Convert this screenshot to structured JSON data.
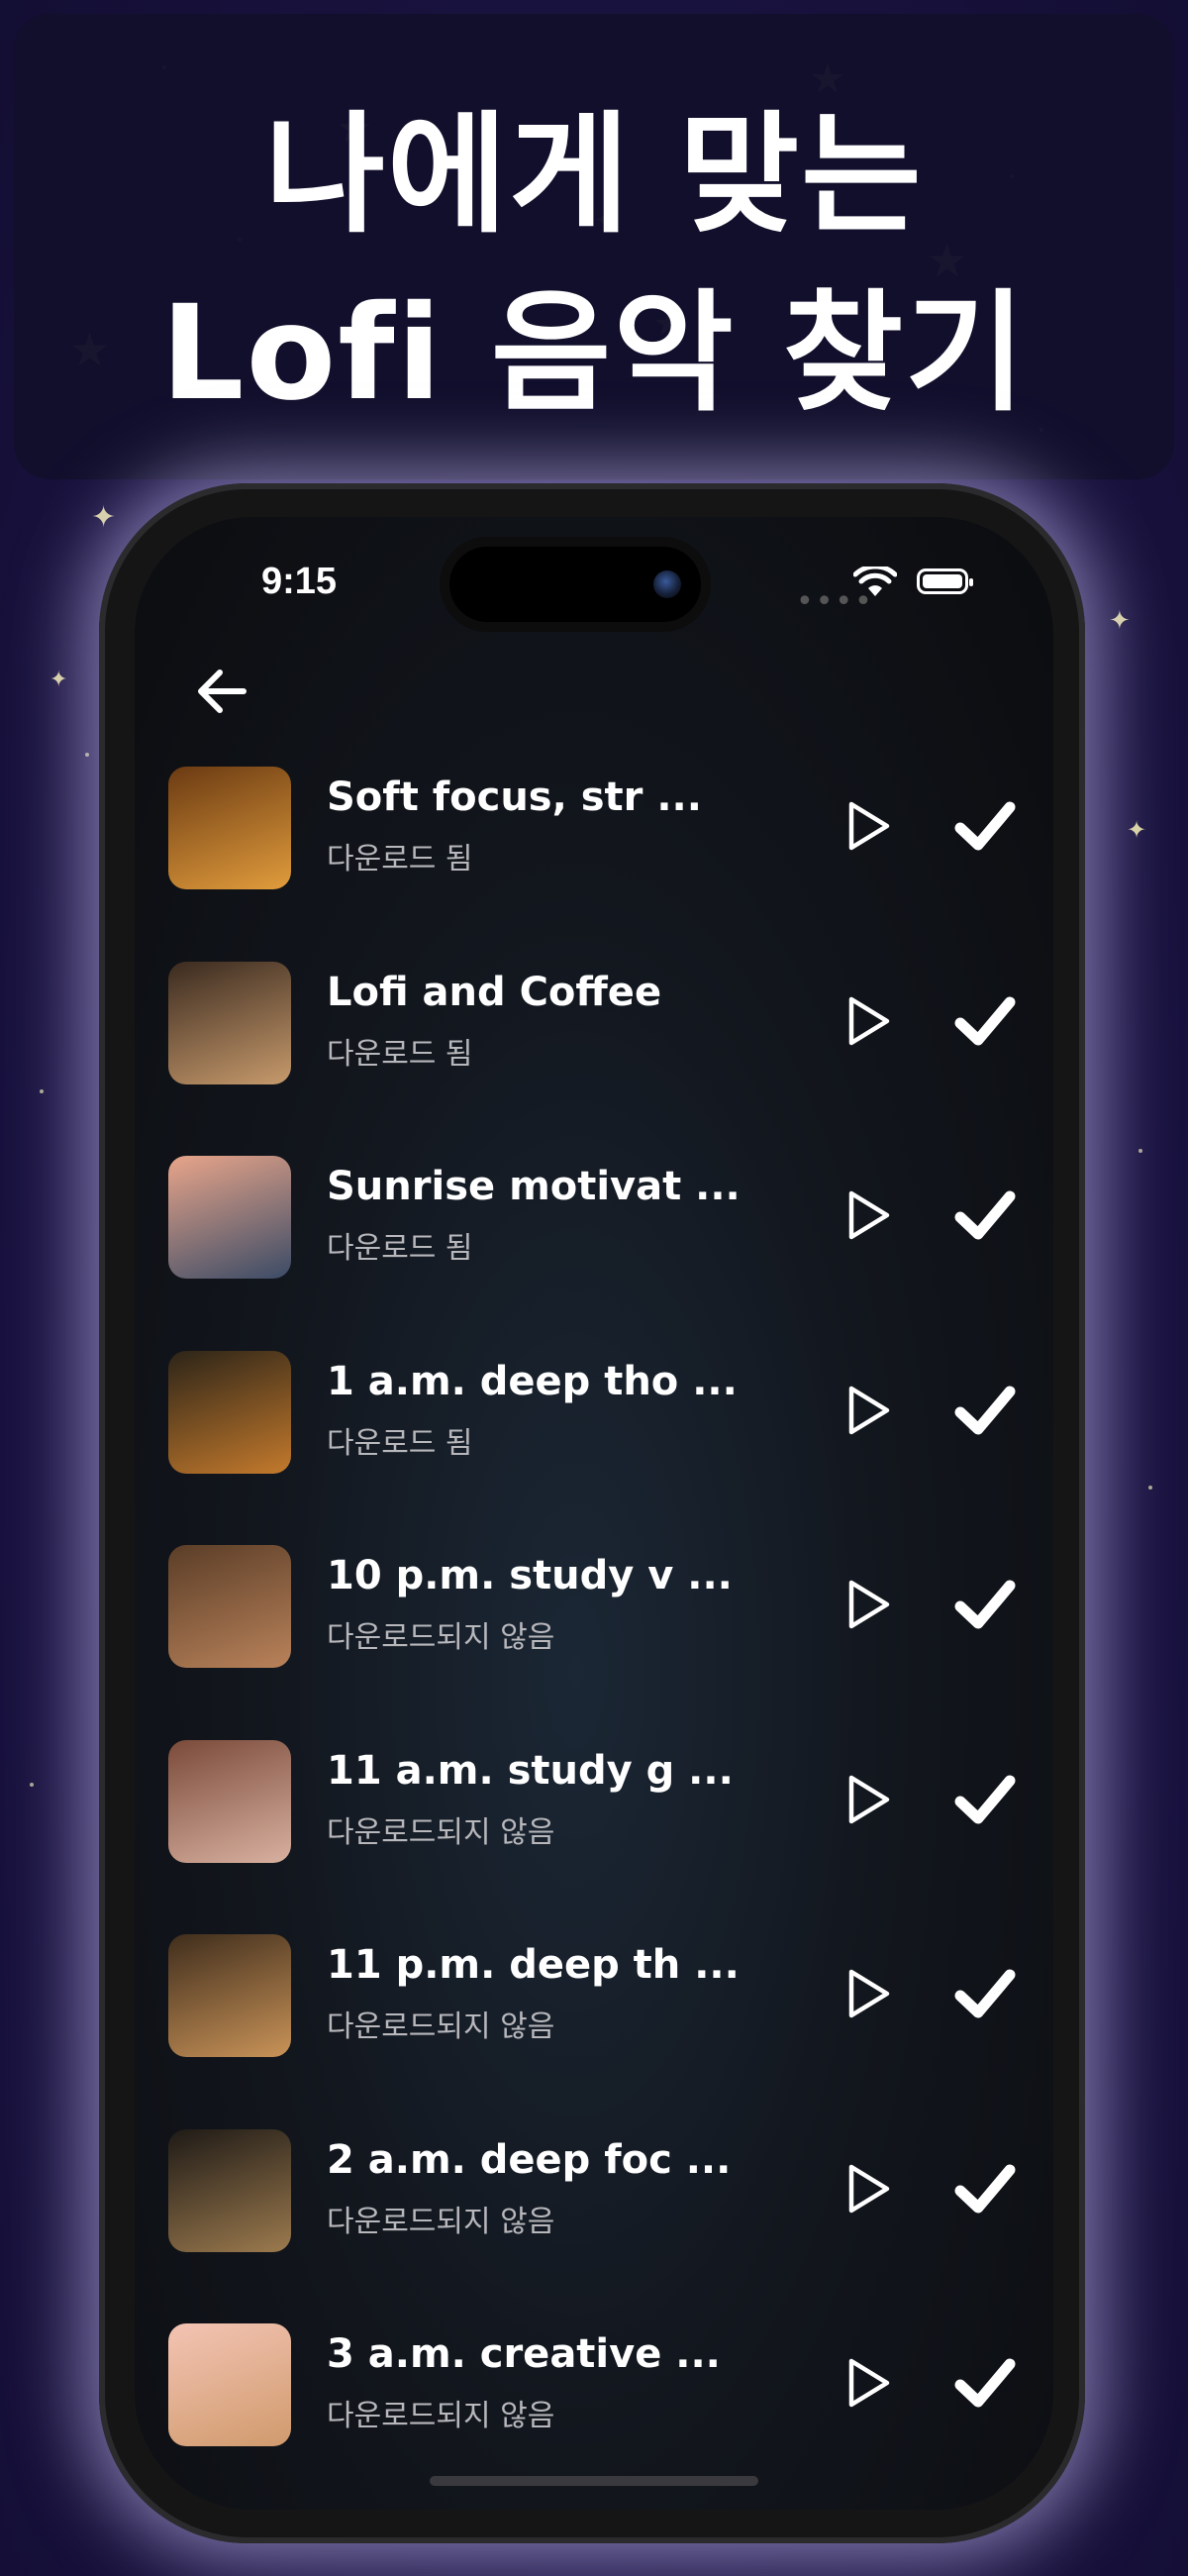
{
  "banner": {
    "line1": "나에게 맞는",
    "line2": "Lofi 음악 찾기"
  },
  "status_bar": {
    "time": "9:15"
  },
  "icons": {
    "back": "arrow-left-icon",
    "play": "play-icon",
    "check": "check-icon"
  },
  "tracks": [
    {
      "title": "Soft focus, str ...",
      "status": "다운로드 됨",
      "thumb_colors": [
        "#6a3a12",
        "#e19c3c"
      ]
    },
    {
      "title": "Lofi and Coffee",
      "status": "다운로드 됨",
      "thumb_colors": [
        "#3a2a1f",
        "#c79a6c"
      ]
    },
    {
      "title": "Sunrise motivat ...",
      "status": "다운로드 됨",
      "thumb_colors": [
        "#e8a58a",
        "#3b4b66"
      ]
    },
    {
      "title": "1 a.m. deep tho ...",
      "status": "다운로드 됨",
      "thumb_colors": [
        "#2c2418",
        "#c47a2c"
      ]
    },
    {
      "title": "10 p.m. study v ...",
      "status": "다운로드되지 않음",
      "thumb_colors": [
        "#5a3d27",
        "#b9825a"
      ]
    },
    {
      "title": "11 a.m. study g ...",
      "status": "다운로드되지 않음",
      "thumb_colors": [
        "#7a4a3a",
        "#d9b1a0"
      ]
    },
    {
      "title": "11 p.m. deep th ...",
      "status": "다운로드되지 않음",
      "thumb_colors": [
        "#3f2d1c",
        "#c99358"
      ]
    },
    {
      "title": "2 a.m. deep foc ...",
      "status": "다운로드되지 않음",
      "thumb_colors": [
        "#1e1a16",
        "#9c7a4e"
      ]
    },
    {
      "title": "3 a.m. creative ...",
      "status": "다운로드되지 않음",
      "thumb_colors": [
        "#f3c4b4",
        "#d09a6c"
      ]
    }
  ]
}
